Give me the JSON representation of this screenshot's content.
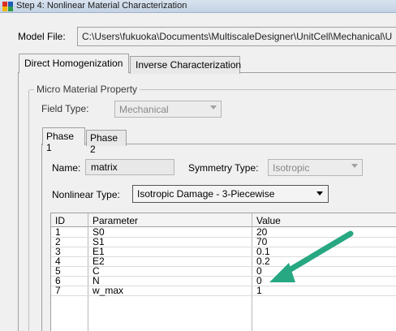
{
  "window": {
    "title": "Step 4: Nonlinear Material Characterization"
  },
  "model_file": {
    "label": "Model File:",
    "path": "C:\\Users\\fukuoka\\Documents\\MultiscaleDesigner\\UnitCell\\Mechanical\\U"
  },
  "tabs": {
    "direct": "Direct Homogenization",
    "inverse": "Inverse Characterization"
  },
  "micro": {
    "legend": "Micro Material Property",
    "field_type_label": "Field Type:",
    "field_type_value": "Mechanical"
  },
  "phase_tabs": {
    "phase1": "Phase 1",
    "phase2": "Phase 2"
  },
  "phase": {
    "name_label": "Name:",
    "name_value": "matrix",
    "symmetry_label": "Symmetry Type:",
    "symmetry_value": "Isotropic",
    "nonlinear_label": "Nonlinear Type:",
    "nonlinear_value": "Isotropic Damage - 3-Piecewise"
  },
  "table": {
    "headers": {
      "id": "ID",
      "parameter": "Parameter",
      "value": "Value"
    },
    "rows": [
      {
        "id": "1",
        "parameter": "S0",
        "value": "20"
      },
      {
        "id": "2",
        "parameter": "S1",
        "value": "70"
      },
      {
        "id": "3",
        "parameter": "E1",
        "value": "0.1"
      },
      {
        "id": "4",
        "parameter": "E2",
        "value": "0.2"
      },
      {
        "id": "5",
        "parameter": "C",
        "value": "0"
      },
      {
        "id": "6",
        "parameter": "N",
        "value": "0"
      },
      {
        "id": "7",
        "parameter": "w_max",
        "value": "1"
      }
    ]
  },
  "annotation": {
    "arrow_color": "#27a882"
  }
}
